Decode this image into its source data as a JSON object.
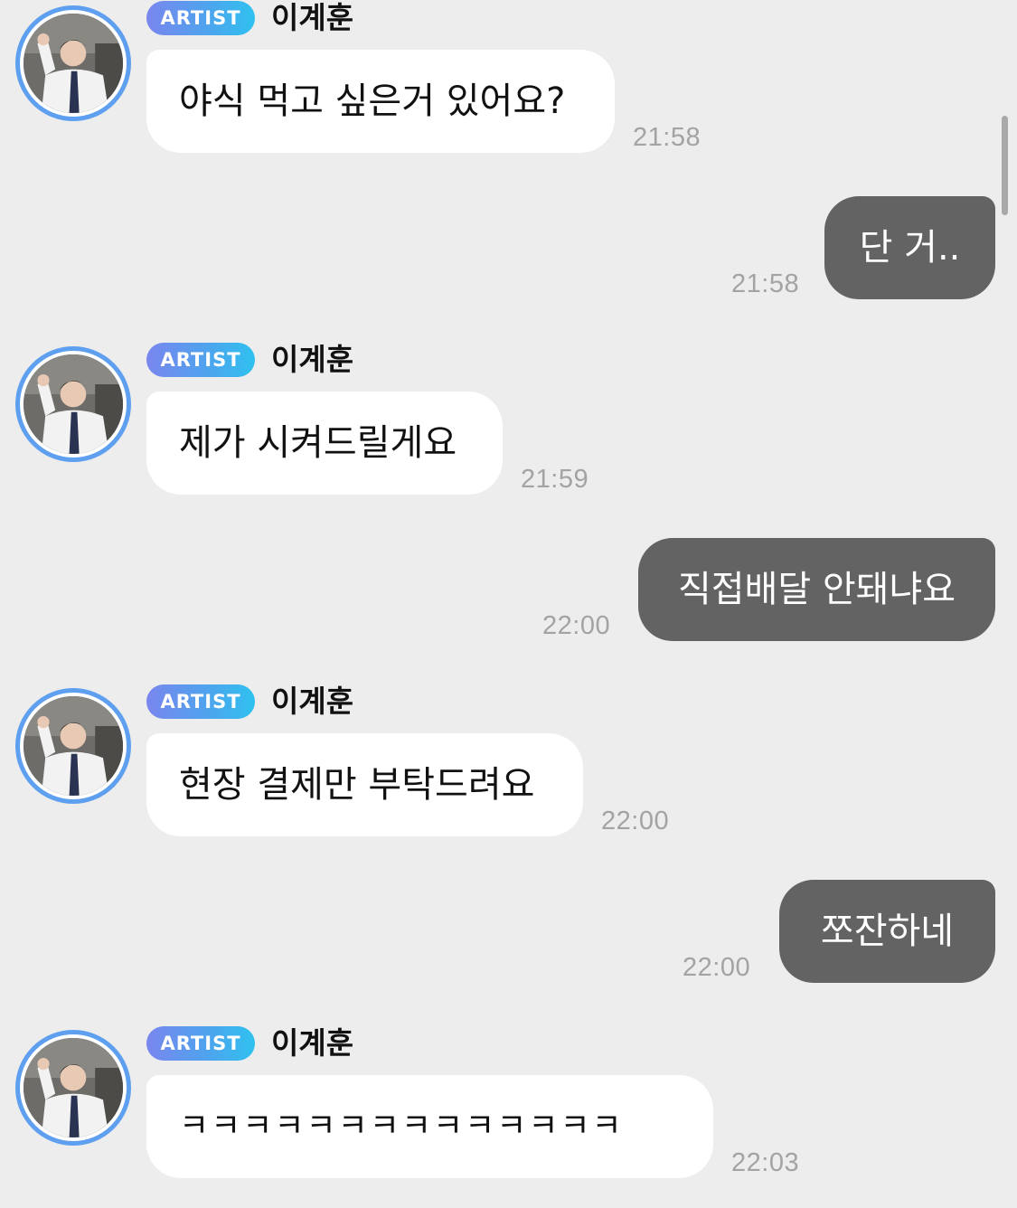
{
  "messages": [
    {
      "type": "artist",
      "badge": "ARTIST",
      "sender": "이계훈",
      "text": "야식 먹고 싶은거 있어요?",
      "time": "21:58"
    },
    {
      "type": "fan",
      "text": "단 거..",
      "time": "21:58"
    },
    {
      "type": "artist",
      "badge": "ARTIST",
      "sender": "이계훈",
      "text": "제가 시켜드릴게요",
      "time": "21:59"
    },
    {
      "type": "fan",
      "text": "직접배달 안돼냐요",
      "time": "22:00"
    },
    {
      "type": "artist",
      "badge": "ARTIST",
      "sender": "이계훈",
      "text": "현장 결제만 부탁드려요",
      "time": "22:00"
    },
    {
      "type": "fan",
      "text": "쪼잔하네",
      "time": "22:00"
    },
    {
      "type": "artist",
      "badge": "ARTIST",
      "sender": "이계훈",
      "text": "ㅋㅋㅋㅋㅋㅋㅋㅋㅋㅋㅋㅋㅋㅋ",
      "time": "22:03"
    }
  ],
  "colors": {
    "background": "#ededed",
    "artist_bubble": "#ffffff",
    "fan_bubble": "#636363",
    "badge_gradient_start": "#7a86ee",
    "badge_gradient_end": "#2fc1ef",
    "avatar_ring": "#5ea0ef",
    "timestamp": "#a3a3a3"
  }
}
